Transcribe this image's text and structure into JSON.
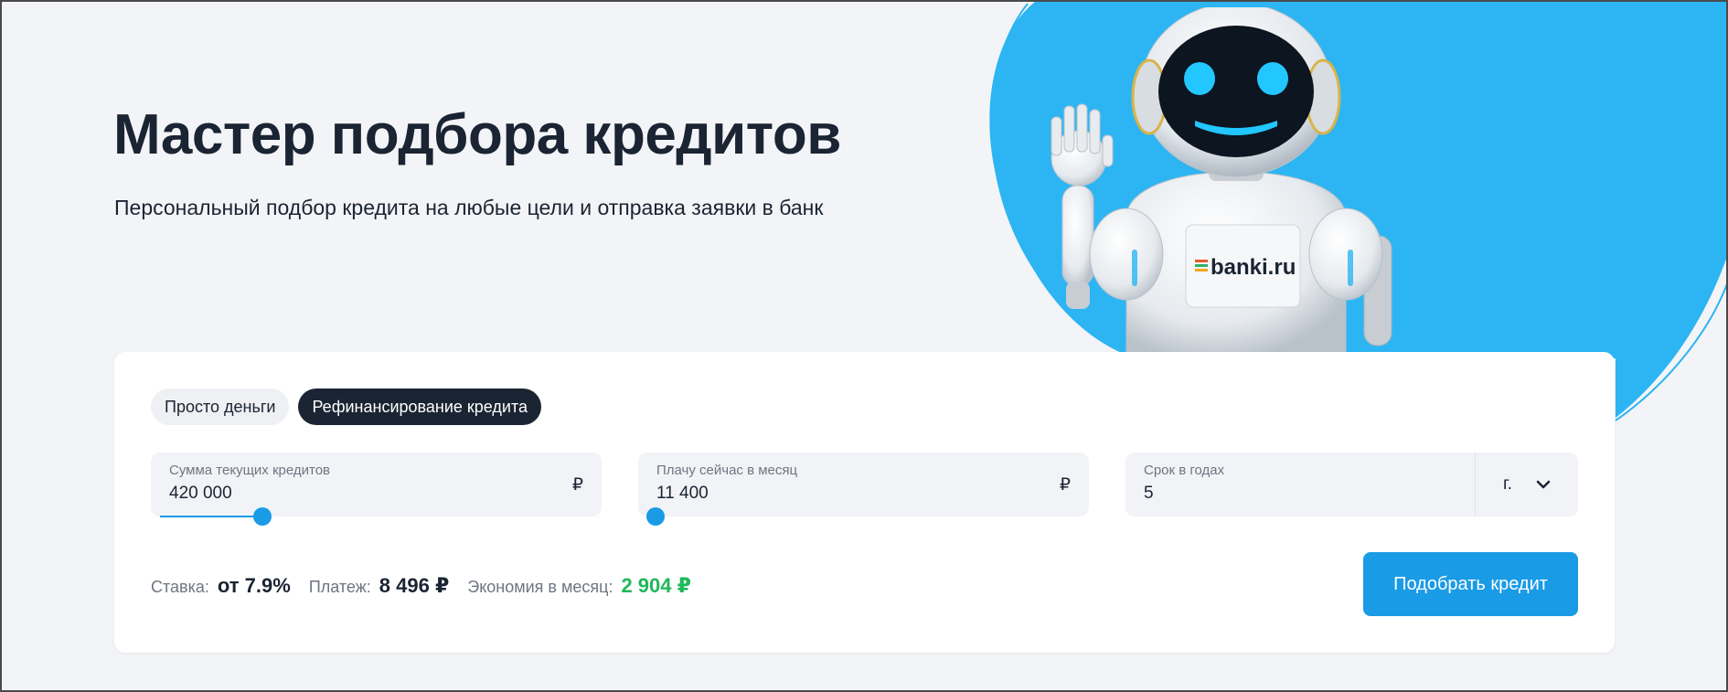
{
  "hero": {
    "title": "Мастер подбора кредитов",
    "subtitle": "Персональный подбор кредита на любые цели и отправка заявки в банк",
    "robot_badge": "banki.ru",
    "accent_color": "#2db5f3"
  },
  "tabs": [
    {
      "label": "Просто деньги",
      "active": false
    },
    {
      "label": "Рефинансирование кредита",
      "active": true
    }
  ],
  "fields": {
    "current_loans": {
      "label": "Сумма текущих кредитов",
      "value": "420 000",
      "currency": "₽",
      "slider_fraction": 0.23
    },
    "monthly_payment": {
      "label": "Плачу сейчас в месяц",
      "value": "11 400",
      "currency": "₽",
      "slider_fraction": 0.0
    },
    "term": {
      "label": "Срок в годах",
      "value": "5",
      "unit": "г."
    }
  },
  "summary": {
    "rate_label": "Ставка:",
    "rate_value": "от 7.9%",
    "payment_label": "Платеж:",
    "payment_value": "8 496 ₽",
    "savings_label": "Экономия в месяц:",
    "savings_value": "2 904 ₽"
  },
  "cta": {
    "label": "Подобрать кредит"
  },
  "colors": {
    "primary": "#1a9be6",
    "dark": "#1b2433",
    "green": "#1eb85a"
  }
}
